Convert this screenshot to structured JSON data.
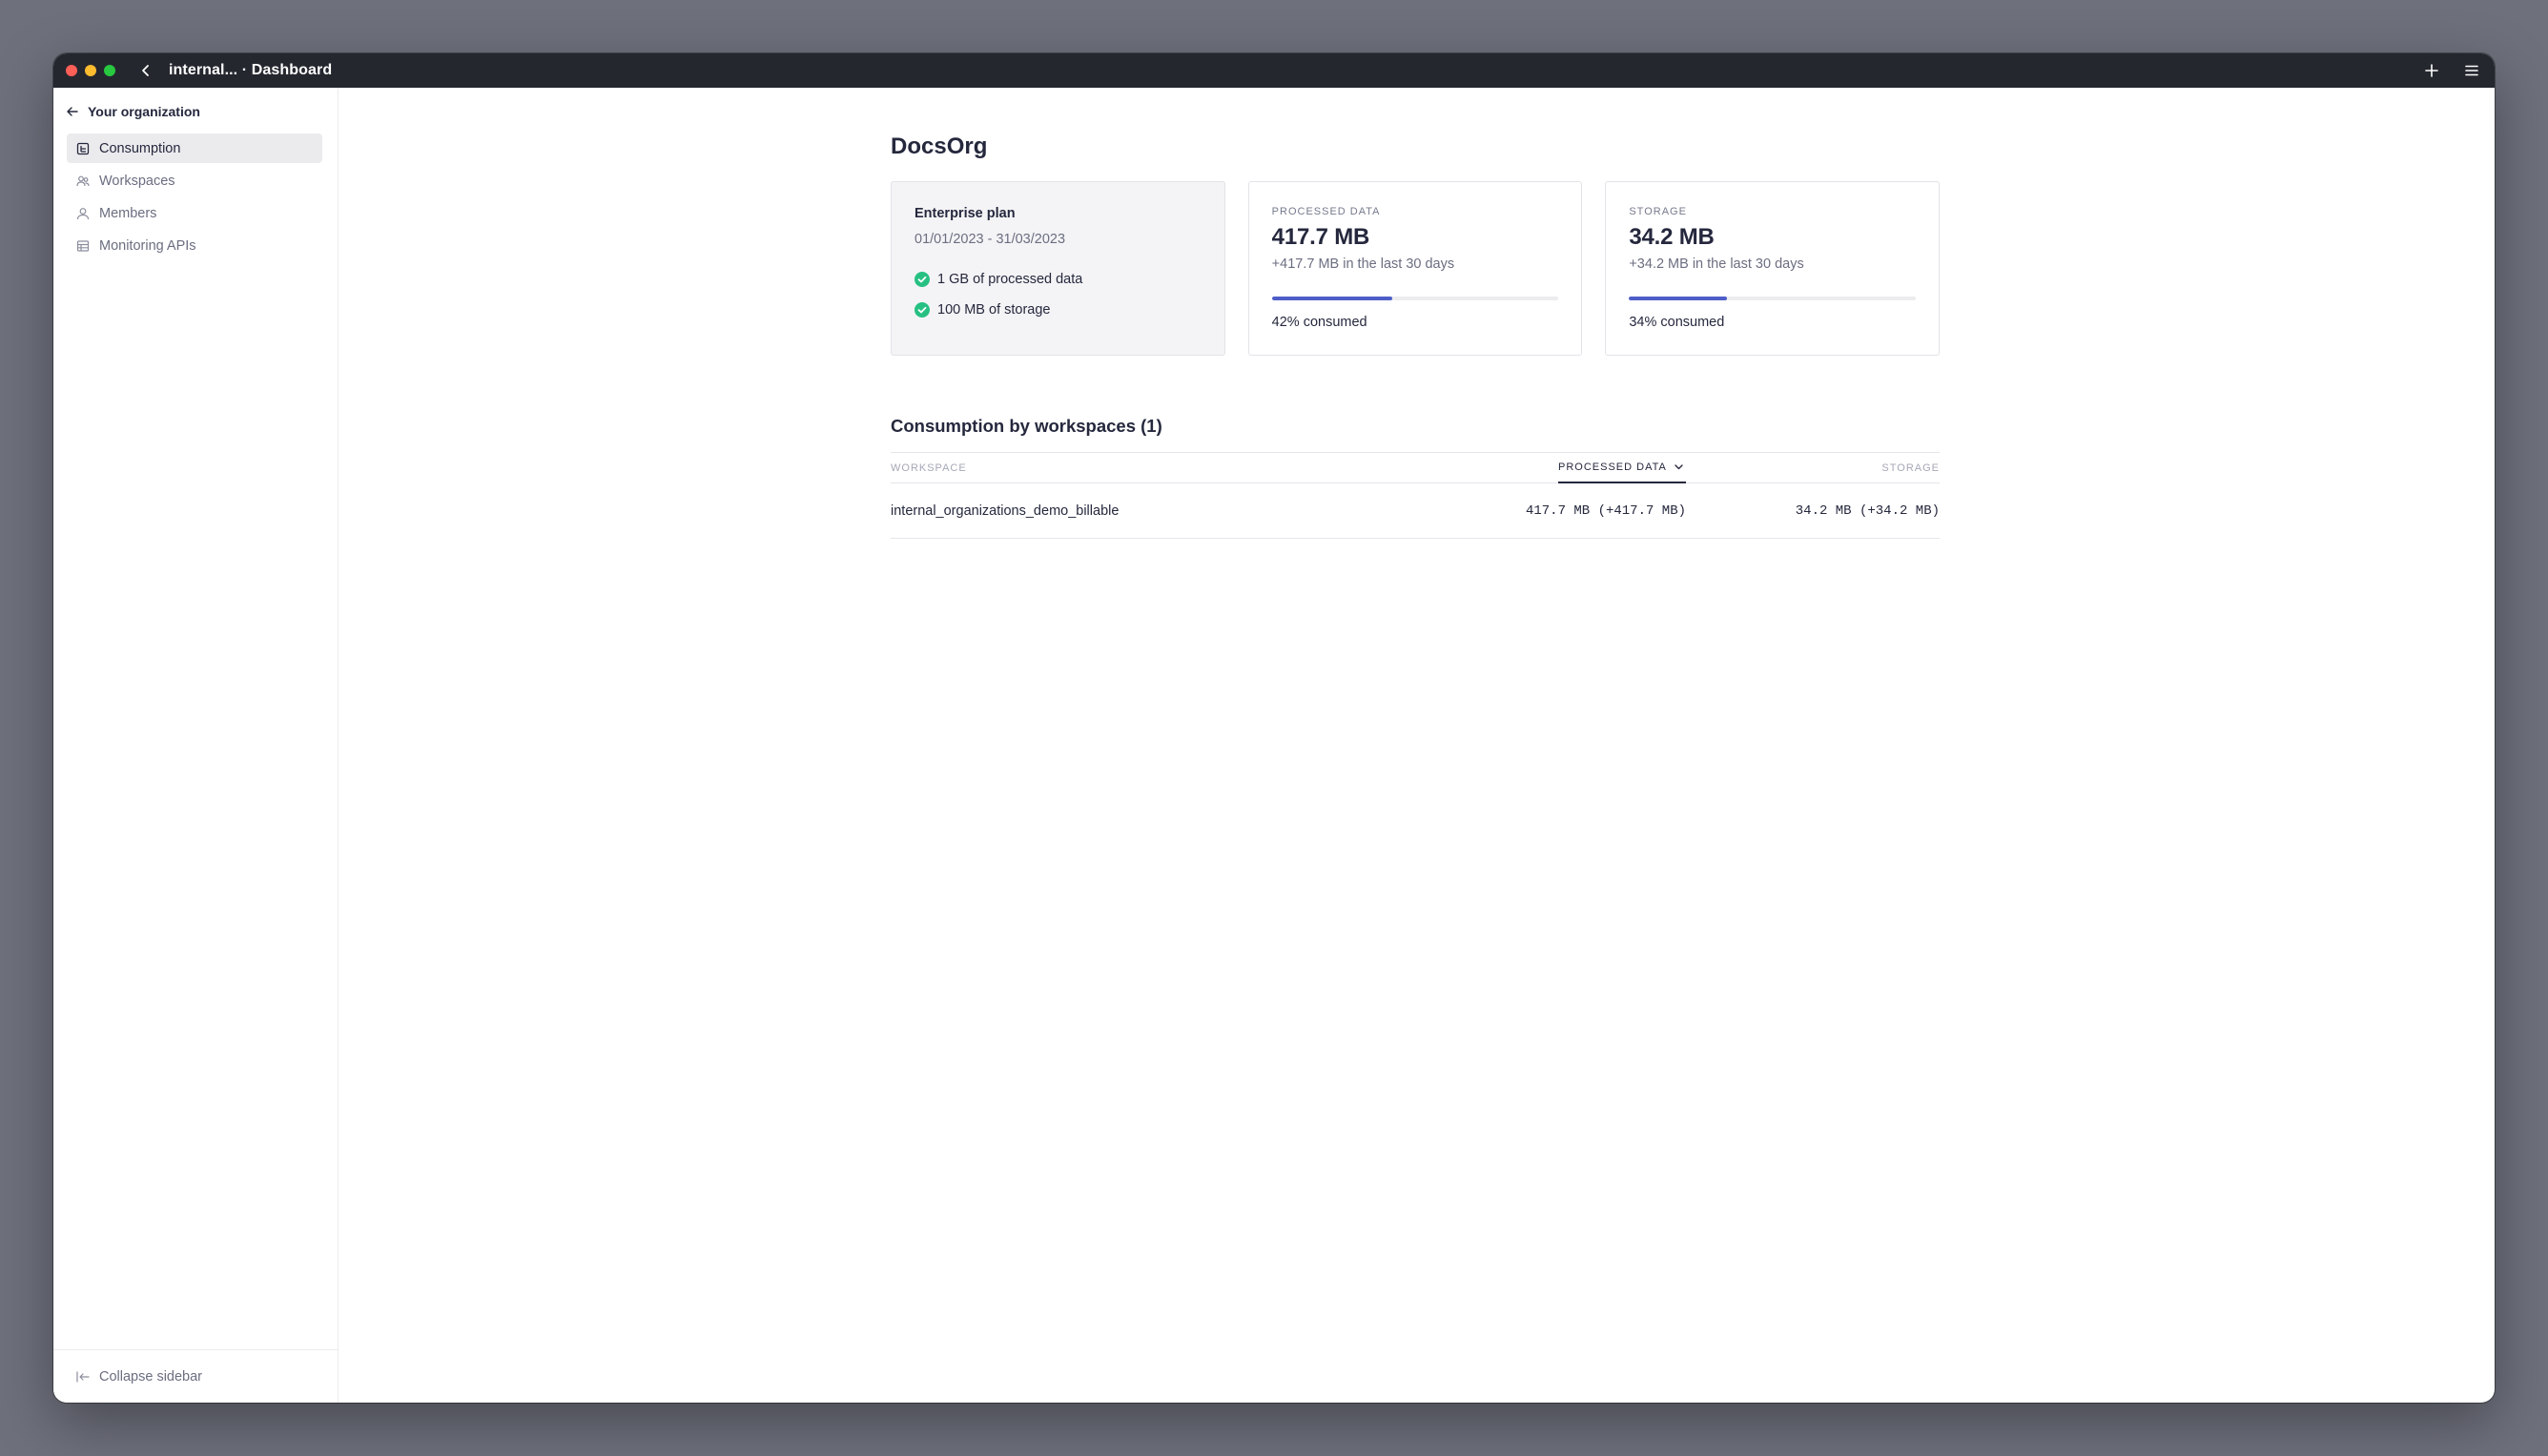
{
  "titlebar": {
    "title": "internal... · Dashboard"
  },
  "sidebar": {
    "back_label": "Your organization",
    "items": [
      {
        "label": "Consumption",
        "icon": "consumption-icon",
        "active": true
      },
      {
        "label": "Workspaces",
        "icon": "workspaces-icon",
        "active": false
      },
      {
        "label": "Members",
        "icon": "person-icon",
        "active": false
      },
      {
        "label": "Monitoring APIs",
        "icon": "table-icon",
        "active": false
      }
    ],
    "collapse_label": "Collapse sidebar"
  },
  "main": {
    "org_name": "DocsOrg",
    "plan": {
      "name": "Enterprise plan",
      "dates": "01/01/2023 - 31/03/2023",
      "features": [
        "1 GB of processed data",
        "100 MB of storage"
      ]
    },
    "processed": {
      "label": "PROCESSED DATA",
      "value": "417.7 MB",
      "delta": "+417.7 MB in the last 30 days",
      "consumed_text": "42% consumed",
      "consumed_fraction": 0.42
    },
    "storage": {
      "label": "STORAGE",
      "value": "34.2 MB",
      "delta": "+34.2 MB in the last 30 days",
      "consumed_text": "34% consumed",
      "consumed_fraction": 0.34
    },
    "section_title": "Consumption by workspaces (1)",
    "table": {
      "headers": {
        "workspace": "WORKSPACE",
        "processed": "PROCESSED DATA",
        "storage": "STORAGE"
      },
      "rows": [
        {
          "workspace": "internal_organizations_demo_billable",
          "processed": "417.7 MB (+417.7 MB)",
          "storage": "34.2 MB (+34.2 MB)"
        }
      ]
    }
  },
  "colors": {
    "accent": "#4e5ec8",
    "check": "#27c083",
    "titlebar": "#25272f"
  }
}
